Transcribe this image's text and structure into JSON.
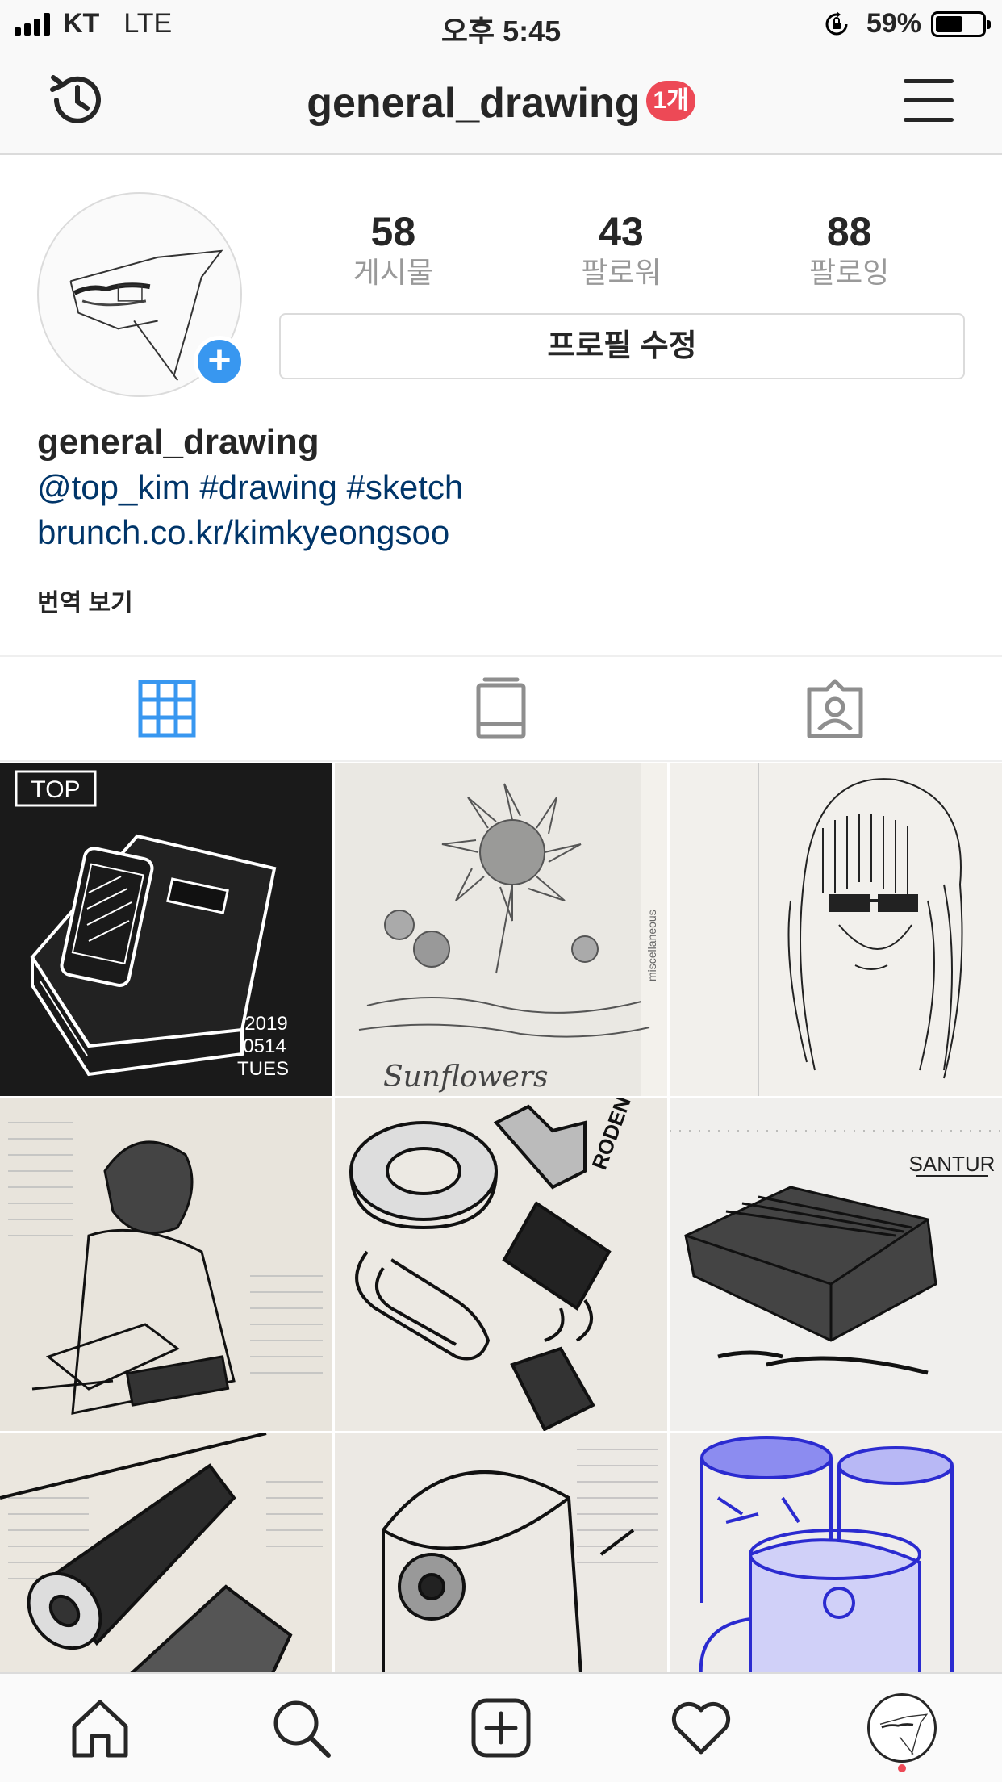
{
  "status_bar": {
    "carrier": "KT",
    "network": "LTE",
    "time": "오후 5:45",
    "battery": "59%",
    "battery_level": 0.59
  },
  "nav": {
    "username": "general_drawing",
    "badge": "1개",
    "icons": [
      "history-icon",
      "menu-icon"
    ]
  },
  "profile": {
    "stats": [
      {
        "value": "58",
        "label": "게시물"
      },
      {
        "value": "43",
        "label": "팔로워"
      },
      {
        "value": "88",
        "label": "팔로잉"
      }
    ],
    "edit_button": "프로필 수정",
    "name": "general_drawing",
    "bio_line1": "@top_kim #drawing #sketch",
    "bio_line2": "brunch.co.kr/kimkyeongsoo",
    "translate": "번역 보기"
  },
  "tabs": [
    "grid-icon",
    "igtv-icon",
    "tagged-icon"
  ],
  "grid": {
    "posts": [
      {
        "name": "post-phone-notebook",
        "text": [
          "TOP",
          "2019",
          "0514",
          "TUES"
        ]
      },
      {
        "name": "post-sunflowers",
        "text": [
          "Sunflowers",
          "miscellaneous"
        ]
      },
      {
        "name": "post-girl-glasses",
        "text": []
      },
      {
        "name": "post-boy-writing",
        "text": []
      },
      {
        "name": "post-clips-tape",
        "text": [
          "RODEN"
        ]
      },
      {
        "name": "post-santur",
        "text": [
          "SANTUR"
        ]
      },
      {
        "name": "post-tube-bottle",
        "text": []
      },
      {
        "name": "post-backpack",
        "text": []
      },
      {
        "name": "post-blue-cups",
        "text": []
      }
    ]
  },
  "bottom_bar": [
    "home-icon",
    "search-icon",
    "new-post-icon",
    "activity-icon",
    "profile-icon"
  ]
}
